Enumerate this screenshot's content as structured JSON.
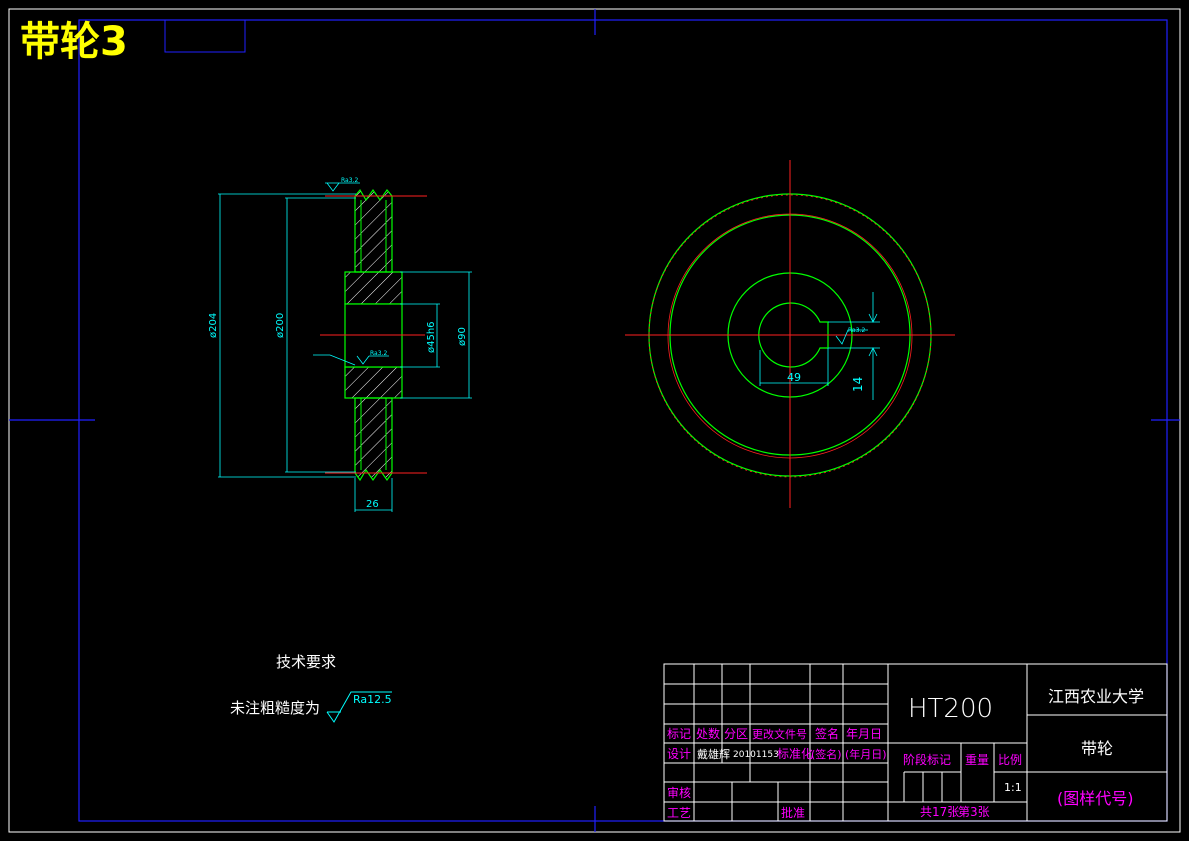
{
  "drawing": {
    "title": "带轮3",
    "tech_requirements": {
      "heading": "技术要求",
      "note": "未注粗糙度为",
      "roughness": "Ra12.5"
    },
    "dimensions": {
      "outer_dia": "ø204",
      "pitch_dia": "ø200",
      "hub_dia": "ø90",
      "bore_dia": "ø45h6",
      "width": "26",
      "keyway_depth": "49",
      "keyway_width": "14",
      "roughness_top": "Ra3.2",
      "roughness_bore": "Ra3.2",
      "roughness_key": "Ra3.2"
    }
  },
  "title_block": {
    "material": "HT200",
    "institution": "江西农业大学",
    "part_name": "带轮",
    "drawing_code": "(图样代号)",
    "row_labels": {
      "mark": "标记",
      "count": "处数",
      "zone": "分区",
      "change_doc": "更改文件号",
      "sign": "签名",
      "date": "年月日",
      "design": "设计",
      "designer": "戴雄辉",
      "designer_id": "20101153",
      "standard": "标准化",
      "sign2": "(签名)",
      "date2": "(年月日)",
      "review": "审核",
      "process": "工艺",
      "approve": "批准"
    },
    "stage_mark": "阶段标记",
    "weight": "重量",
    "scale_label": "比例",
    "scale": "1:1",
    "sheets_total": "共17张",
    "sheet_no": "第3张"
  }
}
